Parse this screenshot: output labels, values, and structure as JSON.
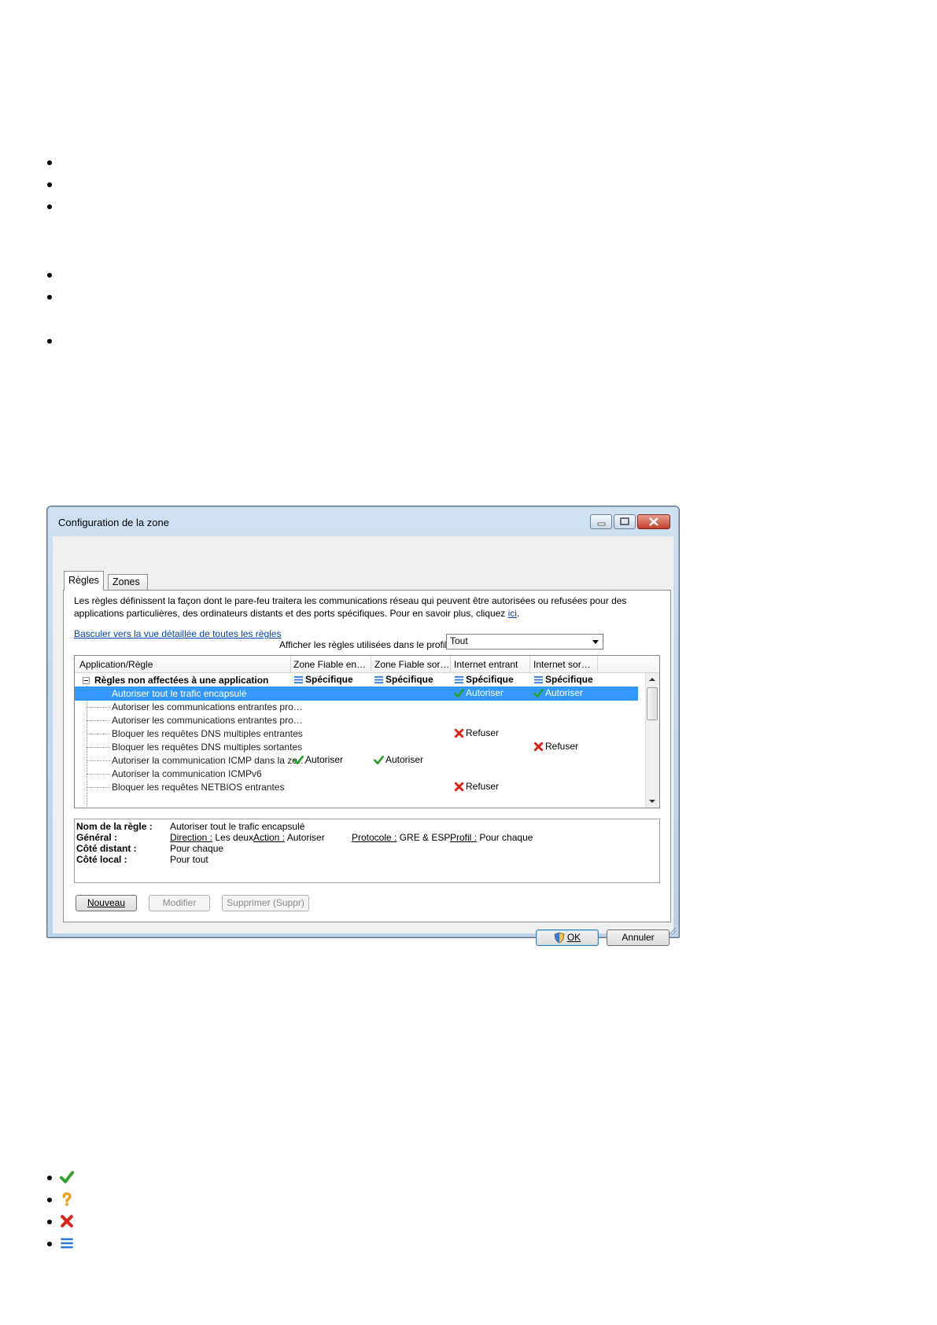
{
  "window": {
    "title": "Configuration de la zone",
    "tabs": [
      "Règles",
      "Zones"
    ],
    "description": "Les règles définissent la façon dont le pare-feu traitera les communications réseau qui peuvent être autorisées ou refusées pour des applications particulières, des ordinateurs distants et des ports spécifiques. Pour en savoir plus, cliquez",
    "description_link": "ici",
    "switch_link": "Basculer vers la vue détaillée de toutes les règles",
    "profile_label": "Afficher les règles utilisées dans le profil :",
    "profile_value": "Tout",
    "columns": [
      "Application/Règle",
      "Zone Fiable en…",
      "Zone Fiable sor…",
      "Internet entrant",
      "Internet sor…"
    ],
    "group": {
      "name": "Règles non affectées à une application",
      "cells": [
        "Spécifique",
        "Spécifique",
        "Spécifique",
        "Spécifique"
      ]
    },
    "rules": [
      {
        "name": "Autoriser tout le trafic encapsulé",
        "cells": [
          "",
          "",
          "Autoriser",
          "Autoriser"
        ],
        "selected": true
      },
      {
        "name": "Autoriser les communications entrantes pro…",
        "cells": [
          "",
          "",
          "",
          ""
        ]
      },
      {
        "name": "Autoriser les communications entrantes pro…",
        "cells": [
          "",
          "",
          "",
          ""
        ]
      },
      {
        "name": "Bloquer les requêtes DNS multiples entrantes",
        "cells": [
          "",
          "",
          "Refuser",
          ""
        ]
      },
      {
        "name": "Bloquer les requêtes DNS multiples sortantes",
        "cells": [
          "",
          "",
          "",
          "Refuser"
        ]
      },
      {
        "name": "Autoriser la communication ICMP dans la zo…",
        "cells": [
          "Autoriser",
          "Autoriser",
          "",
          ""
        ]
      },
      {
        "name": "Autoriser la communication ICMPv6",
        "cells": [
          "",
          "",
          "",
          ""
        ]
      },
      {
        "name": "Bloquer les requêtes NETBIOS entrantes",
        "cells": [
          "",
          "",
          "Refuser",
          ""
        ]
      }
    ],
    "details": {
      "name_label": "Nom de la règle :",
      "name_value": "Autoriser tout le trafic encapsulé",
      "general_label": "Général :",
      "direction_label": "Direction :",
      "direction_value": "Les deux",
      "action_label": "Action :",
      "action_value": "Autoriser",
      "protocol_label": "Protocole :",
      "protocol_value": "GRE & ESP",
      "profile_label": "Profil :",
      "profile_value": "Pour chaque",
      "remote_label": "Côté distant :",
      "remote_value": "Pour chaque",
      "local_label": "Côté local :",
      "local_value": "Pour tout"
    },
    "buttons": {
      "new": "Nouveau",
      "edit": "Modifier",
      "delete": "Supprimer (Suppr)",
      "ok": "OK",
      "cancel": "Annuler"
    }
  },
  "icons": {
    "allow": "check-icon",
    "ask": "question-icon",
    "deny": "cross-icon",
    "specific": "list-icon"
  },
  "colors": {
    "allow": "#2ea02e",
    "ask": "#f0a020",
    "deny": "#d9261c",
    "specific": "#2f7bd6",
    "selection": "#3399ff"
  }
}
